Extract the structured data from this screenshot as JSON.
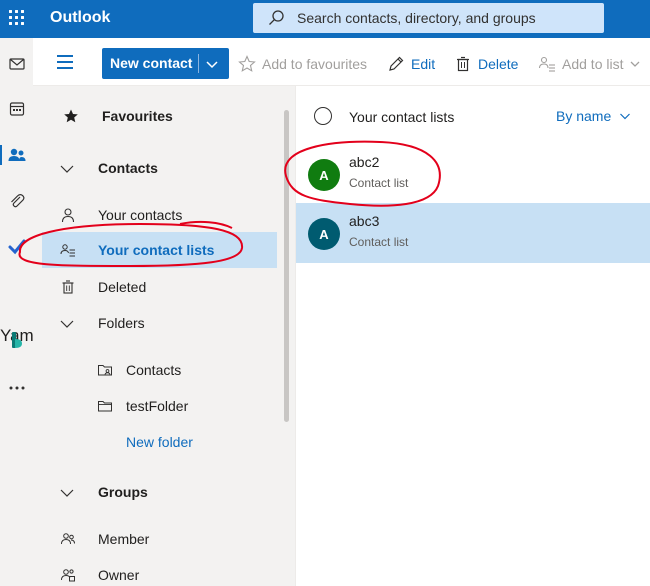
{
  "header": {
    "app_title": "Outlook",
    "search_placeholder": "Search contacts, directory, and groups"
  },
  "rail": {
    "items": [
      {
        "icon": "mail-icon"
      },
      {
        "icon": "calendar-icon"
      },
      {
        "icon": "people-icon",
        "active": true
      },
      {
        "icon": "paperclip-icon"
      },
      {
        "icon": "todo-check-icon"
      },
      {
        "icon": "yammer-text",
        "label": "Yamı"
      },
      {
        "icon": "bookings-icon"
      },
      {
        "icon": "more-icon"
      }
    ]
  },
  "toolbar": {
    "new_contact_label": "New contact",
    "add_favourites_label": "Add to favourites",
    "edit_label": "Edit",
    "delete_label": "Delete",
    "add_to_list_label": "Add to list"
  },
  "nav": {
    "favourites_label": "Favourites",
    "contacts_label": "Contacts",
    "your_contacts_label": "Your contacts",
    "your_contact_lists_label": "Your contact lists",
    "deleted_label": "Deleted",
    "folders_label": "Folders",
    "folder_contacts_label": "Contacts",
    "folder_test_label": "testFolder",
    "new_folder_label": "New folder",
    "groups_label": "Groups",
    "member_label": "Member",
    "owner_label": "Owner"
  },
  "list": {
    "title": "Your contact lists",
    "sort_label": "By name",
    "contacts": [
      {
        "initial": "A",
        "name": "abc2",
        "subtitle": "Contact list",
        "color": "#107c10"
      },
      {
        "initial": "A",
        "name": "abc3",
        "subtitle": "Contact list",
        "color": "#005b70"
      }
    ]
  },
  "colors": {
    "brand": "#0f6cbd",
    "selection": "#c7e0f4",
    "annotation": "#e3001b"
  }
}
